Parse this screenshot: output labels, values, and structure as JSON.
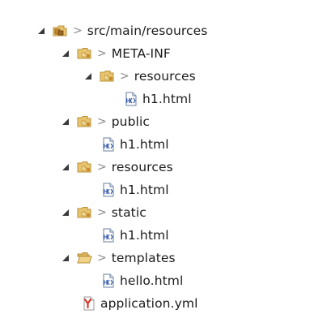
{
  "tree": {
    "root": {
      "decoration": ">",
      "label": "src/main/resources",
      "icon": "package-folder-icon",
      "expanded": true
    },
    "meta_inf": {
      "decoration": ">",
      "label": "META-INF",
      "icon": "folder-icon",
      "expanded": true
    },
    "meta_inf_resources": {
      "decoration": ">",
      "label": "resources",
      "icon": "folder-icon",
      "expanded": true
    },
    "meta_inf_resources_h1": {
      "label": "h1.html",
      "icon": "html-file-icon"
    },
    "public": {
      "decoration": ">",
      "label": "public",
      "icon": "folder-icon",
      "expanded": true
    },
    "public_h1": {
      "label": "h1.html",
      "icon": "html-file-icon"
    },
    "resources": {
      "decoration": ">",
      "label": "resources",
      "icon": "folder-icon",
      "expanded": true
    },
    "resources_h1": {
      "label": "h1.html",
      "icon": "html-file-icon"
    },
    "static": {
      "decoration": ">",
      "label": "static",
      "icon": "folder-icon",
      "expanded": true
    },
    "static_h1": {
      "label": "h1.html",
      "icon": "html-file-icon"
    },
    "templates": {
      "decoration": ">",
      "label": "templates",
      "icon": "folder-open-icon",
      "expanded": true
    },
    "templates_hello": {
      "label": "hello.html",
      "icon": "html-file-icon"
    },
    "application_yml": {
      "label": "application.yml",
      "icon": "yaml-file-icon"
    }
  },
  "colors": {
    "folder": "#e8c46c",
    "folder_dark": "#b8903a",
    "package": "#c98a2c",
    "html_icon": "#3a5fb0",
    "yaml_icon": "#d53a2b",
    "toggle": "#3a3a3a",
    "decoration": "#8a8a8a"
  }
}
